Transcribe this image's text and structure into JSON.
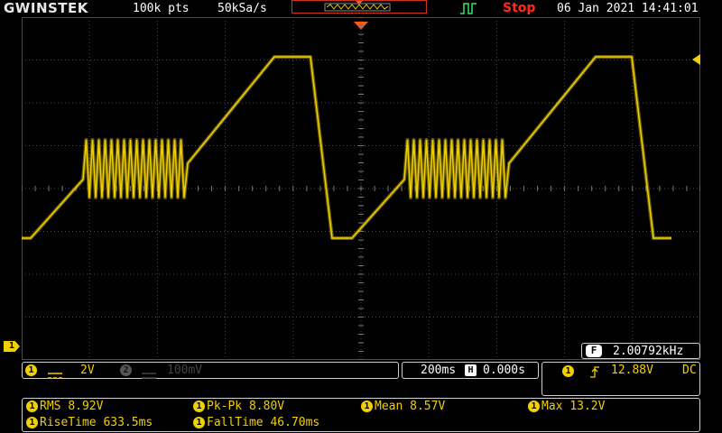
{
  "header": {
    "logo": "GWINSTEK",
    "record_length": "100k pts",
    "sample_rate": "50kSa/s",
    "run_state": "Stop",
    "datetime": "06 Jan 2021 14:41:01"
  },
  "colors": {
    "ch1": "#f0d000",
    "stop": "#ff2a1a",
    "trigger": "#ff5a1a",
    "grid": "#4a4a4a"
  },
  "frequency": {
    "icon": "F",
    "value": "2.00792kHz"
  },
  "ch1": {
    "num": "1",
    "coupling_icon": "dc-coupling-icon",
    "scale": "2V"
  },
  "ch2": {
    "num": "2",
    "scale": "100mV"
  },
  "timebase": {
    "scale": "200ms",
    "icon": "H",
    "position": "0.000s"
  },
  "trigger": {
    "source": "1",
    "slope_icon": "rising-edge-icon",
    "level": "12.88V",
    "coupling": "DC"
  },
  "channel_marker": "1",
  "measurements": [
    {
      "num": "1",
      "label": "RMS",
      "value": "8.92V"
    },
    {
      "num": "1",
      "label": "Pk-Pk",
      "value": "8.80V"
    },
    {
      "num": "1",
      "label": "Mean",
      "value": "8.57V"
    },
    {
      "num": "1",
      "label": "Max",
      "value": "13.2V"
    },
    {
      "num": "1",
      "label": "RiseTime",
      "value": "633.5ms"
    },
    {
      "num": "1",
      "label": "FallTime",
      "value": "46.70ms"
    }
  ]
}
